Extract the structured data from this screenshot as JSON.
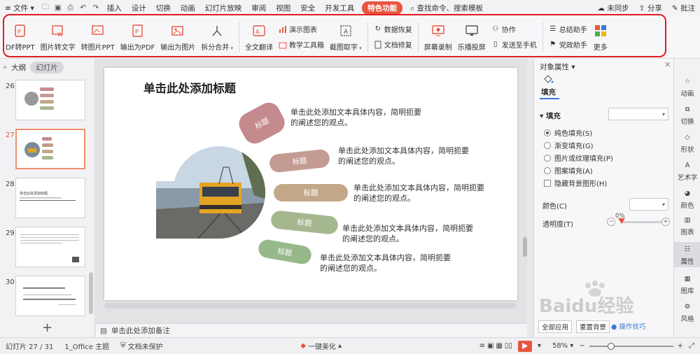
{
  "menubar": {
    "file": "文件",
    "tabs": [
      "插入",
      "设计",
      "切换",
      "动画",
      "幻灯片放映",
      "审阅",
      "视图",
      "安全",
      "开发工具"
    ],
    "special": "特色功能",
    "search": "查找命令、搜索模板",
    "sync": "未同步",
    "share": "分享",
    "comment": "批注"
  },
  "ribbon": {
    "pdf_to_ppt": "DF转PPT",
    "img_to_text": "图片转文字",
    "img_to_ppt": "转图片PPT",
    "export_pdf": "输出为PDF",
    "export_img": "输出为图片",
    "split_merge": "拆分合并",
    "full_translate": "全文翻译",
    "demo_chart": "演示图表",
    "teach_toolbox": "教学工具箱",
    "screenshot_text": "截图取字",
    "data_recovery": "数据恢复",
    "doc_repair": "文档修复",
    "screen_record": "屏幕录制",
    "lebo_cast": "乐播投屏",
    "collab": "协作",
    "send_phone": "发送至手机",
    "summary_assistant": "总结助手",
    "party_assistant": "党政助手",
    "more": "更多"
  },
  "leftpanel": {
    "tab_outline": "大纲",
    "tab_slides": "幻灯片",
    "slides": [
      {
        "num": "26"
      },
      {
        "num": "27"
      },
      {
        "num": "28",
        "title": "单击此处添加标题"
      },
      {
        "num": "29"
      },
      {
        "num": "30"
      }
    ],
    "add": "+"
  },
  "slide": {
    "title": "单击此处添加标题",
    "items": [
      {
        "label": "标题",
        "text": "单击此处添加文本具体内容，简明扼要的阐述您的观点。",
        "color": "#c58a8e"
      },
      {
        "label": "标题",
        "text": "单击此处添加文本具体内容，简明扼要的阐述您的观点。",
        "color": "#c39b92"
      },
      {
        "label": "标题",
        "text": "单击此处添加文本具体内容，简明扼要的阐述您的观点。",
        "color": "#c2a888"
      },
      {
        "label": "标题",
        "text": "单击此处添加文本具体内容，简明扼要的阐述您的观点。",
        "color": "#a5b78f"
      },
      {
        "label": "标题",
        "text": "单击此处添加文本具体内容，简明扼要的阐述您的观点。",
        "color": "#97b98a"
      }
    ]
  },
  "notes": {
    "placeholder": "单击此处添加备注"
  },
  "props": {
    "title": "对象属性",
    "tab_fill": "填充",
    "section_fill": "填充",
    "options": [
      {
        "label": "纯色填充(S)",
        "checked": true
      },
      {
        "label": "渐变填充(G)",
        "checked": false
      },
      {
        "label": "图片或纹理填充(P)",
        "checked": false
      },
      {
        "label": "图案填充(A)",
        "checked": false
      }
    ],
    "hide_bg": "隐藏背景图形(H)",
    "color": "颜色(C)",
    "transparency": "透明度(T)",
    "transparency_value": "0%",
    "apply_all": "全部应用",
    "reset": "重置背景",
    "tips": "操作技巧"
  },
  "rside": [
    "动画",
    "切换",
    "形状",
    "艺术字",
    "颜色",
    "图表",
    "属性",
    "图库",
    "风格"
  ],
  "status": {
    "slide_pos": "幻灯片 27 / 31",
    "theme": "1_Office 主题",
    "protect": "文档未保护",
    "beautify": "一键美化",
    "zoom": "58%"
  },
  "watermark": {
    "text": "Baidu经验"
  },
  "colors": {
    "accent": "#e8553e",
    "highlight": "#e21c22"
  }
}
